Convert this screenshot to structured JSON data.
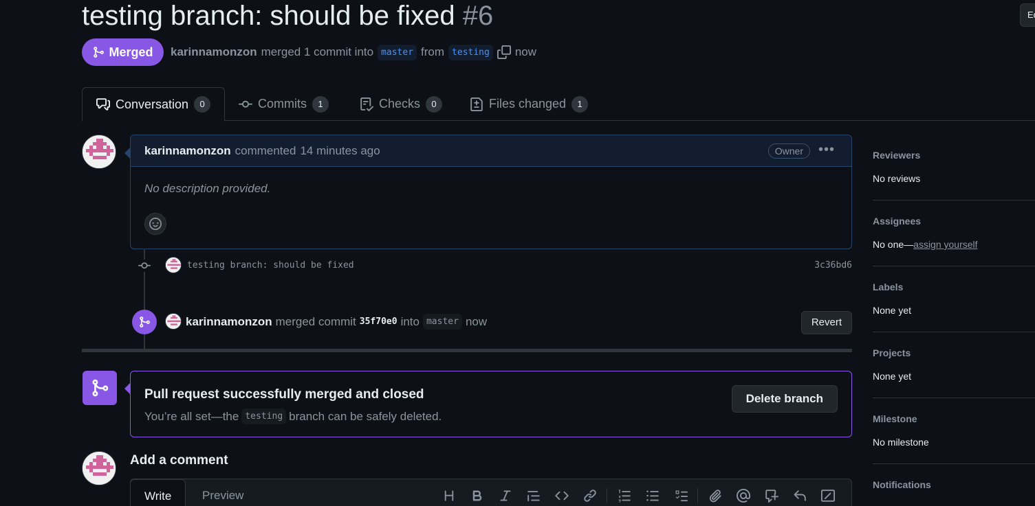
{
  "header": {
    "title": "testing branch: should be fixed",
    "number": "#6",
    "edit_label": "Ed",
    "state": "Merged",
    "meta": {
      "author": "karinnamonzon",
      "merged_text": "merged 1 commit into",
      "base_branch": "master",
      "from_text": "from",
      "head_branch": "testing",
      "time": "now"
    }
  },
  "tabs": [
    {
      "label": "Conversation",
      "count": "0",
      "icon": "comment-discussion-icon"
    },
    {
      "label": "Commits",
      "count": "1",
      "icon": "git-commit-icon"
    },
    {
      "label": "Checks",
      "count": "0",
      "icon": "checklist-icon"
    },
    {
      "label": "Files changed",
      "count": "1",
      "icon": "file-diff-icon"
    }
  ],
  "comment": {
    "author": "karinnamonzon",
    "action": "commented",
    "time": "14 minutes ago",
    "role": "Owner",
    "body": "No description provided."
  },
  "commit": {
    "message": "testing branch: should be fixed",
    "sha": "3c36bd6"
  },
  "merge_event": {
    "author": "karinnamonzon",
    "text1": "merged commit",
    "sha": "35f70e0",
    "text2": "into",
    "branch": "master",
    "time": "now",
    "revert_label": "Revert"
  },
  "merged_box": {
    "title": "Pull request successfully merged and closed",
    "sub_prefix": "You’re all set—the",
    "branch": "testing",
    "sub_suffix": "branch can be safely deleted.",
    "delete_label": "Delete branch"
  },
  "add_comment": {
    "title": "Add a comment",
    "write_tab": "Write",
    "preview_tab": "Preview"
  },
  "sidebar": {
    "reviewers": {
      "label": "Reviewers",
      "value": "No reviews"
    },
    "assignees": {
      "label": "Assignees",
      "value": "No one—",
      "link": "assign yourself"
    },
    "labels": {
      "label": "Labels",
      "value": "None yet"
    },
    "projects": {
      "label": "Projects",
      "value": "None yet"
    },
    "milestone": {
      "label": "Milestone",
      "value": "No milestone"
    },
    "notifications": {
      "label": "Notifications"
    }
  },
  "colors": {
    "background": "#0d1117",
    "merged_purple": "#8957e5",
    "link_blue": "#4493f8",
    "border": "#30363d"
  }
}
